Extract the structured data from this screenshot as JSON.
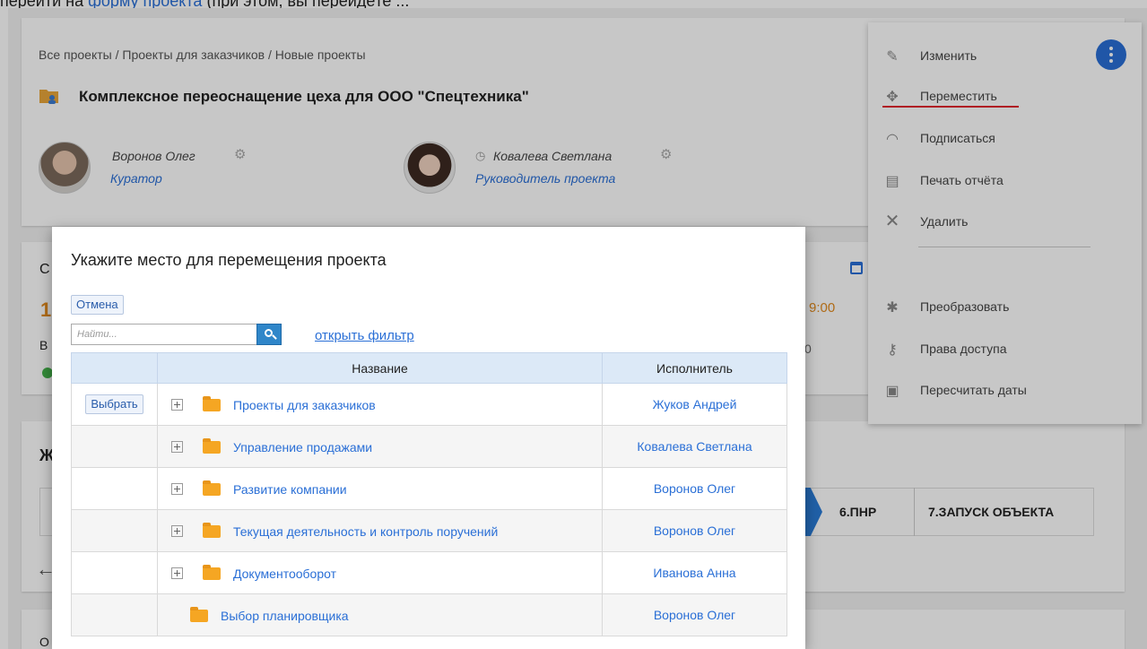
{
  "top_line": {
    "prefix": "перейти на",
    "link": "форму проекта",
    "suffix": "(при этом, вы ",
    "tail": "перейдёте ..."
  },
  "project": {
    "breadcrumb": "Все проекты / Проекты для заказчиков / Новые проекты",
    "title": "Комплексное переоснащение цеха для ООО \"Спецтехника\"",
    "curator": {
      "name": "Воронов Олег",
      "role": "Куратор"
    },
    "manager": {
      "name": "Ковалева Светлана",
      "role": "Руководитель проекта"
    }
  },
  "background": {
    "mid_letter_c": "С",
    "mid_number": "1",
    "mid_letter_b": "В",
    "time": "9:00",
    "zero": "0",
    "life_letter": "Ж",
    "stages": [
      "6.ПНР",
      "7.ЗАПУСК ОБЪЕКТА"
    ],
    "arrow": "←",
    "last_letter": "О"
  },
  "menu": {
    "items": [
      {
        "icon": "pencil-icon",
        "label": "Изменить"
      },
      {
        "icon": "move-icon",
        "label": "Переместить"
      },
      {
        "icon": "rss-icon",
        "label": "Подписаться"
      },
      {
        "icon": "printer-icon",
        "label": "Печать отчёта"
      },
      {
        "icon": "close-icon",
        "label": "Удалить"
      },
      {
        "icon": "magic-wand-icon",
        "label": "Преобразовать"
      },
      {
        "icon": "key-icon",
        "label": "Права доступа"
      },
      {
        "icon": "calendar-recalc-icon",
        "label": "Пересчитать даты"
      }
    ],
    "highlight_color": "#e0262d"
  },
  "modal": {
    "title": "Укажите место для перемещения проекта",
    "cancel_label": "Отмена",
    "search_placeholder": "Найти...",
    "filter_link": "открыть фильтр",
    "columns": {
      "select": "",
      "name": "Название",
      "executor": "Исполнитель"
    },
    "select_label": "Выбрать",
    "rows": [
      {
        "name": "Проекты для заказчиков",
        "executor": "Жуков Андрей",
        "expandable": true
      },
      {
        "name": "Управление продажами",
        "executor": "Ковалева Светлана",
        "expandable": true
      },
      {
        "name": "Развитие компании",
        "executor": "Воронов Олег",
        "expandable": true
      },
      {
        "name": "Текущая деятельность и контроль поручений",
        "executor": "Воронов Олег",
        "expandable": true
      },
      {
        "name": "Документооборот",
        "executor": "Иванова Анна",
        "expandable": true
      },
      {
        "name": "Выбор планировщика",
        "executor": "Воронов Олег",
        "expandable": false
      }
    ]
  },
  "colors": {
    "accent": "#2a6fd6",
    "header_bg": "#dce9f7",
    "folder": "#f5a623"
  }
}
